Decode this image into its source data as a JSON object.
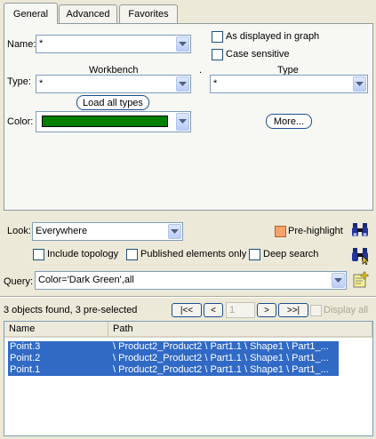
{
  "tabs": [
    "General",
    "Advanced",
    "Favorites"
  ],
  "general": {
    "name_label": "Name:",
    "name_value": "*",
    "as_displayed_label": "As displayed in graph",
    "case_sensitive_label": "Case sensitive",
    "workbench_header": "Workbench",
    "dot_sep": ".",
    "type_header": "Type",
    "type_label": "Type:",
    "workbench_value": "*",
    "type_value": "*",
    "load_all_types": "Load all types",
    "color_label": "Color:",
    "color_swatch": "#008000",
    "more_button": "More..."
  },
  "options": {
    "look_label": "Look:",
    "look_value": "Everywhere",
    "prehighlight_label": "Pre-highlight",
    "include_topology": "Include topology",
    "published_only": "Published elements only",
    "deep_search": "Deep search",
    "query_label": "Query:",
    "query_value": "Color='Dark Green',all"
  },
  "results": {
    "status": "3 objects found, 3 pre-selected",
    "first_btn": "|<<",
    "prev_btn": "<",
    "page_value": "1",
    "next_btn": ">",
    "last_btn": ">>|",
    "display_all": "Display all",
    "columns": [
      "Name",
      "Path"
    ],
    "rows": [
      {
        "name": "Point.3",
        "path": "\\ Product2_Product2 \\ Part1.1 \\ Shape1 \\ Part1_..."
      },
      {
        "name": "Point.2",
        "path": "\\ Product2_Product2 \\ Part1.1 \\ Shape1 \\ Part1_..."
      },
      {
        "name": "Point.1",
        "path": "\\ Product2_Product2 \\ Part1.1 \\ Shape1 \\ Part1_..."
      }
    ]
  },
  "colors": {
    "selection": "#316ac5",
    "accent_border": "#1c4f8f"
  }
}
